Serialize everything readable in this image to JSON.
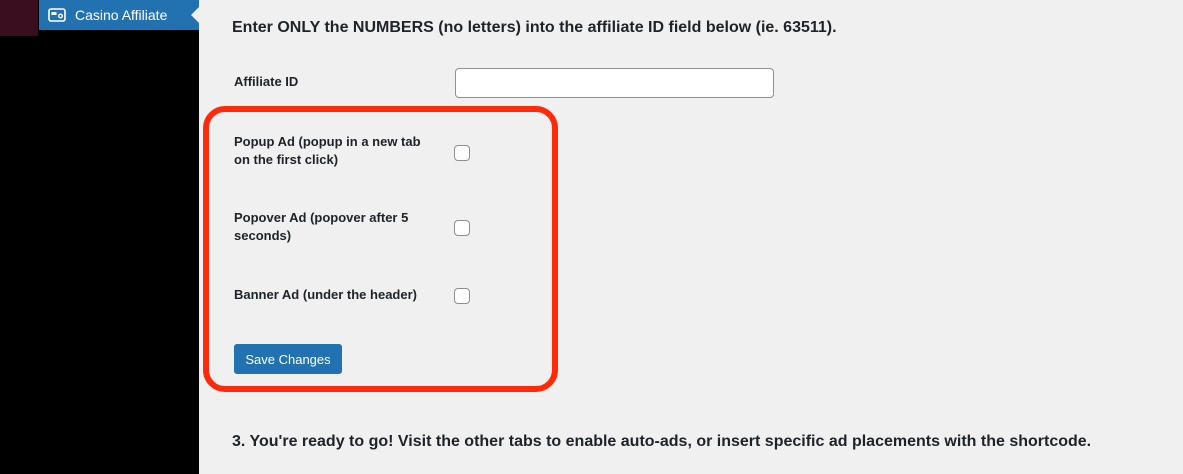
{
  "sidebar": {
    "active_item": {
      "label": "Casino Affiliate",
      "icon": "ad-icon"
    }
  },
  "settings": {
    "instruction": "Enter ONLY the NUMBERS (no letters) into the affiliate ID field below (ie. 63511).",
    "affiliate_id": {
      "label": "Affiliate ID",
      "value": ""
    },
    "options": [
      {
        "label": "Popup Ad (popup in a new tab on the first click)",
        "checked": false
      },
      {
        "label": "Popover Ad (popover after 5 seconds)",
        "checked": false
      },
      {
        "label": "Banner Ad (under the header)",
        "checked": false
      }
    ],
    "save_label": "Save Changes",
    "step_note": "3. You're ready to go! Visit the other tabs to enable auto-ads, or insert specific ad placements with the shortcode."
  },
  "colors": {
    "accent": "#2271b1",
    "highlight": "#ff2a0a",
    "background": "#f0f0f1",
    "sidebar": "#000000"
  }
}
